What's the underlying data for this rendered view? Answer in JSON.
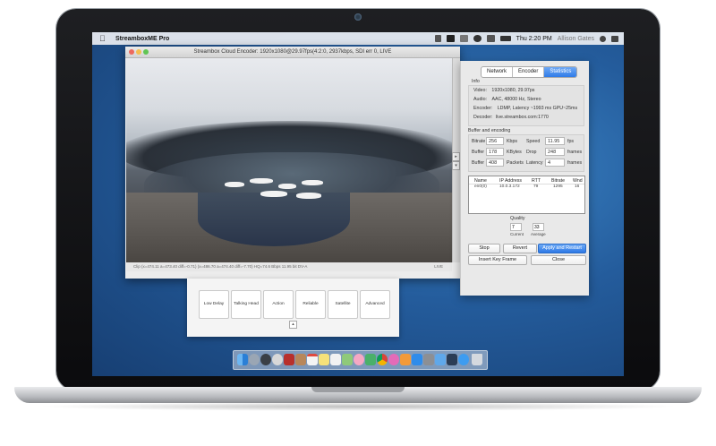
{
  "menubar": {
    "app_name": "StreamboxME Pro",
    "clock": "Thu 2:20 PM",
    "user": "Allison Gates"
  },
  "window": {
    "title": "Streambox Cloud Encoder: 1920x1080@29.97fps(4:2:0, 2937kbps, SDI err 0, LIVE",
    "status_left": "Clip (x=474.11 a=473.40 diff=-0.71) (x=486.70 a=474.40 diff=-7.70) HQ=74.6 Bbps 11.95 bit DV-A",
    "status_right": "LIVE"
  },
  "panel": {
    "tabs": [
      "Network",
      "Encoder",
      "Statistics"
    ],
    "active_tab": "Statistics",
    "info_title": "Info",
    "info": [
      {
        "label": "Video:",
        "value": "1920x1080,  29.97ps"
      },
      {
        "label": "Audio:",
        "value": "AAC, 48000 Hz, Stereo"
      },
      {
        "label": "Encoder:",
        "value": "LDMP, Latency ~1993 ms GPU~25ms"
      },
      {
        "label": "Decoder:",
        "value": "live.streambox.com:1770"
      }
    ],
    "buffer_title": "Buffer and encoding",
    "rows": [
      {
        "label": "Bitrate",
        "value": "256",
        "unit": "Kbps",
        "label2": "Speed",
        "value2": "11.95",
        "unit2": "fps"
      },
      {
        "label": "Buffer",
        "value": "178",
        "unit": "KBytes",
        "label2": "Drop",
        "value2": "248",
        "unit2": "frames"
      },
      {
        "label": "Buffer",
        "value": "408",
        "unit": "Packets",
        "label2": "Latency",
        "value2": "4",
        "unit2": "frames"
      }
    ],
    "table": {
      "columns": [
        "Name",
        "IP Address",
        "RTT",
        "Bitrate",
        "Wnd"
      ],
      "rows": [
        [
          "en0(0)",
          "10.0.3.172",
          "79",
          "1295",
          "16"
        ]
      ]
    },
    "quality_title": "Quality",
    "quality_current": "7",
    "quality_current_label": "Current",
    "quality_average": "33",
    "quality_average_label": "Average",
    "buttons": {
      "stop": "Stop",
      "revert": "Revert",
      "apply": "Apply and Restart",
      "key_frame": "Insert Key Frame",
      "close": "Close"
    }
  },
  "presets": [
    "Low Delay",
    "Talking Head",
    "Action",
    "Reliable",
    "Satellite",
    "Advanced"
  ],
  "colors": {
    "accent": "#2f7be8",
    "desktop": "#245c9c"
  },
  "dock_icons": [
    "finder-icon",
    "launchpad-icon",
    "quicktime-icon",
    "compass-icon",
    "photo-booth-icon",
    "contacts-icon",
    "calendar-icon",
    "notes-icon",
    "reminders-icon",
    "maps-icon",
    "photos-icon",
    "messages-icon",
    "chrome-icon",
    "itunes-icon",
    "ibooks-icon",
    "app-store-icon",
    "system-preferences-icon",
    "mail-icon",
    "streambox-icon",
    "safari-icon",
    "trash-icon"
  ]
}
